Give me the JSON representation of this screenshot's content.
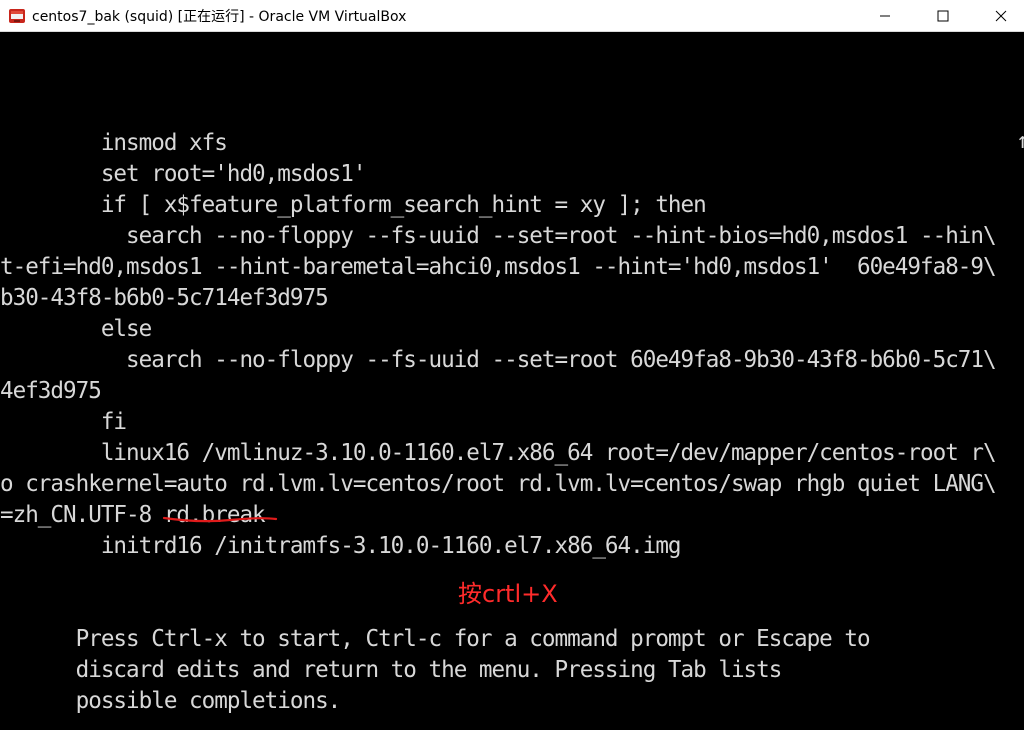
{
  "window": {
    "title": "centos7_bak (squid) [正在运行] - Oracle VM VirtualBox",
    "icon": "virtualbox-icon",
    "controls": [
      "minimize-icon",
      "maximize-icon",
      "close-icon"
    ]
  },
  "terminal": {
    "lines": [
      "        insmod xfs",
      "        set root='hd0,msdos1'",
      "        if [ x$feature_platform_search_hint = xy ]; then",
      "          search --no-floppy --fs-uuid --set=root --hint-bios=hd0,msdos1 --hin\\",
      "t-efi=hd0,msdos1 --hint-baremetal=ahci0,msdos1 --hint='hd0,msdos1'  60e49fa8-9\\",
      "b30-43f8-b6b0-5c714ef3d975",
      "        else",
      "          search --no-floppy --fs-uuid --set=root 60e49fa8-9b30-43f8-b6b0-5c71\\",
      "4ef3d975",
      "        fi",
      "        linux16 /vmlinuz-3.10.0-1160.el7.x86_64 root=/dev/mapper/centos-root r\\",
      "o crashkernel=auto rd.lvm.lv=centos/root rd.lvm.lv=centos/swap rhgb quiet LANG\\",
      "=zh_CN.UTF-8 rd.break",
      "        initrd16 /initramfs-3.10.0-1160.el7.x86_64.img",
      "",
      "",
      "      Press Ctrl-x to start, Ctrl-c for a command prompt or Escape to",
      "      discard edits and return to the menu. Pressing Tab lists",
      "      possible completions."
    ],
    "scroll_marker": "↑"
  },
  "annotation": {
    "text": "按crtl+X",
    "color": "#ff2b2b"
  },
  "colors": {
    "terminal_bg": "#000000",
    "terminal_fg": "#d8d8d8",
    "titlebar_bg": "#ffffff"
  }
}
